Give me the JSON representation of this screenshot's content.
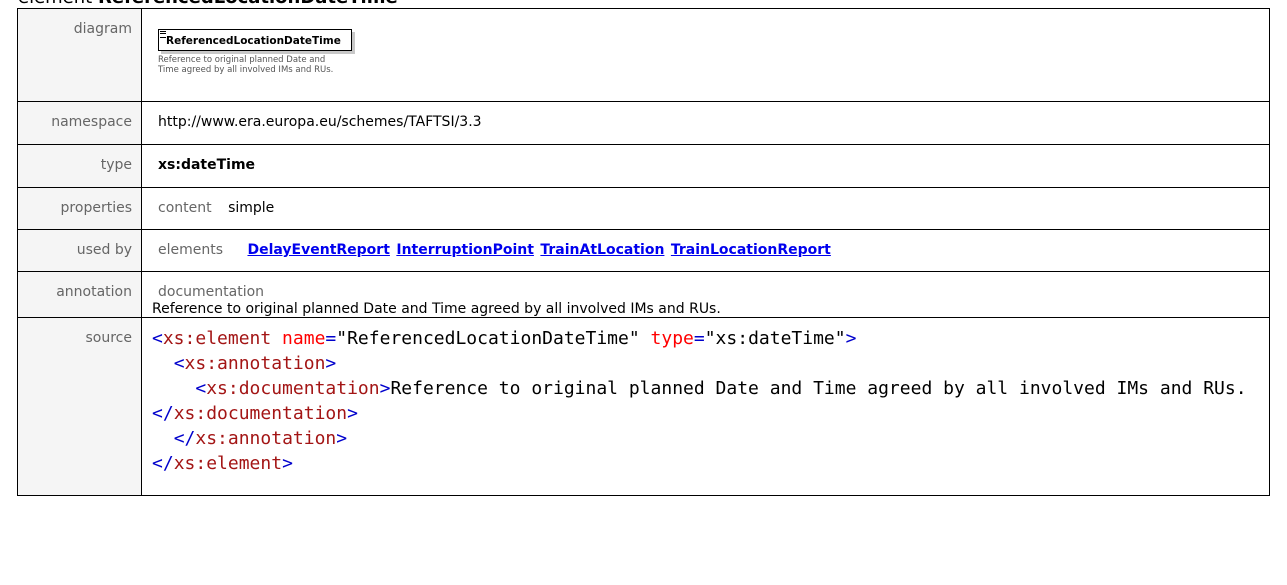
{
  "page": {
    "title_prefix": "element",
    "title_name": "ReferencedLocationDateTime"
  },
  "labels": {
    "diagram": "diagram",
    "namespace": "namespace",
    "type": "type",
    "properties": "properties",
    "used_by": "used by",
    "annotation": "annotation",
    "source": "source"
  },
  "diagram": {
    "element_name": "ReferencedLocationDateTime",
    "documentation": "Reference to original planned Date and Time agreed by all involved IMs and RUs."
  },
  "namespace": "http://www.era.europa.eu/schemes/TAFTSI/3.3",
  "type": "xs:dateTime",
  "properties": {
    "key": "content",
    "value": "simple"
  },
  "used_by": {
    "key": "elements",
    "links": [
      "DelayEventReport",
      "InterruptionPoint",
      "TrainAtLocation",
      "TrainLocationReport"
    ]
  },
  "annotation": {
    "key": "documentation",
    "text": "Reference to original planned Date and Time agreed by all involved IMs and RUs."
  },
  "source": {
    "line1_open": "<",
    "line1_tag": "xs:element",
    "line1_attr1": " name",
    "line1_eq1": "=",
    "line1_val1": "\"ReferencedLocationDateTime\"",
    "line1_attr2": " type",
    "line1_eq2": "=",
    "line1_val2": "\"xs:dateTime\"",
    "line1_close": ">",
    "line2_tag": "xs:annotation",
    "line3_tag": "xs:documentation",
    "line3_text": "Reference to original planned Date and Time agreed by all involved IMs and RUs. ",
    "line3_end_tag": "xs:documentation",
    "line4_end_tag": "xs:annotation",
    "line5_end_tag": "xs:element"
  }
}
